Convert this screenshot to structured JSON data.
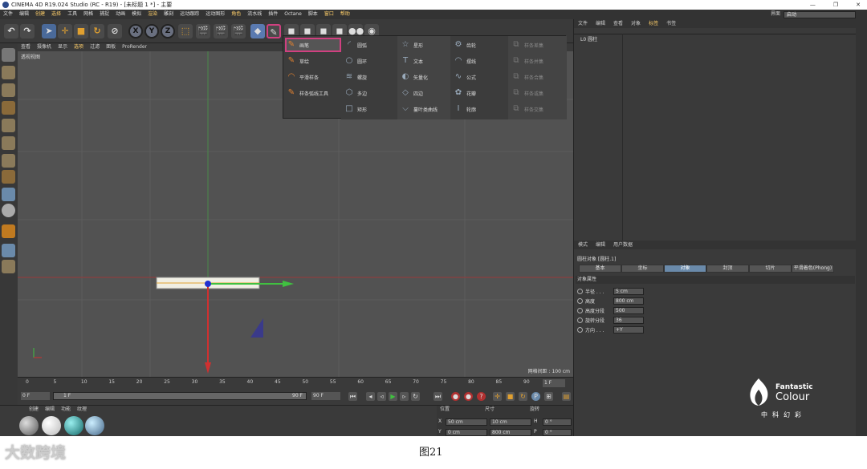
{
  "window": {
    "title": "CINEMA 4D R19.024 Studio (RC - R19) - [未标题 1 *] - 主要",
    "controls": [
      "—",
      "❐",
      "✕"
    ]
  },
  "menu": {
    "items": [
      "文件",
      "编辑",
      "创建",
      "选择",
      "工具",
      "网格",
      "捕捉",
      "动画",
      "模拟",
      "渲染",
      "雕刻",
      "运动跟踪",
      "运动图形",
      "角色",
      "流水线",
      "插件",
      "Octane",
      "脚本",
      "窗口",
      "帮助"
    ],
    "highlighted": [
      2,
      3,
      9,
      13,
      18,
      19
    ]
  },
  "layout": {
    "label": "界面",
    "value": "启动"
  },
  "toolbar": {
    "undo": "↶",
    "redo": "↷",
    "axis_x": "X",
    "axis_y": "Y",
    "axis_z": "Z"
  },
  "viewport": {
    "menu": [
      "查看",
      "摄像机",
      "显示",
      "选项",
      "过滤",
      "面板",
      "ProRender"
    ],
    "menu_highlight": [
      3
    ],
    "name": "透视视图",
    "scale": "网格间距 : 100 cm"
  },
  "spline_popup": {
    "col1": [
      "画笔",
      "草绘",
      "平滑样条",
      "样条弧线工具"
    ],
    "col2": [
      "圆弧",
      "圆环",
      "螺旋",
      "多边",
      "矩形"
    ],
    "col3": [
      "星形",
      "文本",
      "矢量化",
      "四边",
      "蔓叶类曲线"
    ],
    "col4": [
      "齿轮",
      "摆线",
      "公式",
      "花瓣",
      "轮廓"
    ],
    "col5": [
      "样条差集",
      "样条并集",
      "样条合集",
      "样条或集",
      "样条交集"
    ]
  },
  "object_manager": {
    "menu": [
      "文件",
      "编辑",
      "查看",
      "对象",
      "标签",
      "书签"
    ],
    "menu_highlight": [
      4
    ],
    "row": "L0 圆柱"
  },
  "attributes": {
    "menu": [
      "模式",
      "编辑",
      "用户数据"
    ],
    "title": "圆柱对象 [圆柱.1]",
    "tabs": [
      "基本",
      "坐标",
      "对象",
      "封顶",
      "切片",
      "平滑着色(Phong)"
    ],
    "active_tab": 2,
    "section": "对象属性",
    "props": [
      {
        "label": "半径 . . .",
        "value": "5 cm"
      },
      {
        "label": "高度",
        "value": "800 cm"
      },
      {
        "label": "高度分段",
        "value": "500"
      },
      {
        "label": "旋转分段",
        "value": "36"
      },
      {
        "label": "方向 . . .",
        "value": "+Y"
      }
    ]
  },
  "timeline": {
    "ticks": [
      "0",
      "5",
      "10",
      "15",
      "20",
      "25",
      "30",
      "35",
      "40",
      "45",
      "50",
      "55",
      "60",
      "65",
      "70",
      "75",
      "80",
      "85",
      "90"
    ],
    "frame": "1 F",
    "start": "0 F",
    "current": "1 F",
    "end_mid": "90 F",
    "end": "90 F"
  },
  "materials": {
    "menu": [
      "创建",
      "编辑",
      "功能",
      "纹理"
    ]
  },
  "coords": {
    "headers": [
      "位置",
      "尺寸",
      "旋转"
    ],
    "row1": [
      "50 cm",
      "10 cm",
      "0 °"
    ],
    "row2": [
      "0 cm",
      "800 cm",
      "0 °"
    ],
    "axes": [
      "X",
      "Y"
    ],
    "rot_axes": [
      "H",
      "P"
    ]
  },
  "caption": "图21",
  "watermark": "大数跨境",
  "brand": {
    "line1": "Fantastic",
    "line2": "Colour",
    "line3": "中科幻彩"
  }
}
